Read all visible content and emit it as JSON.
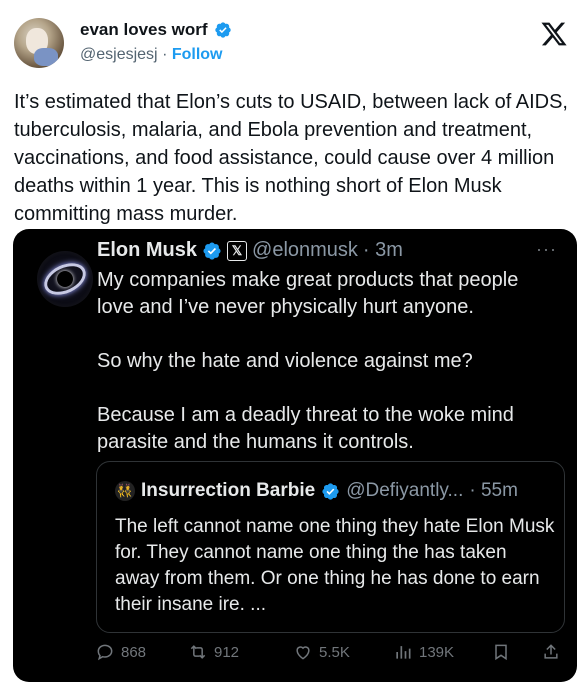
{
  "author": {
    "name": "evan loves worf",
    "handle": "@esjesjesj",
    "separator": "·",
    "follow_label": "Follow"
  },
  "tweet": {
    "text": "It’s estimated that Elon’s cuts to USAID, between lack of AIDS, tuberculosis, malaria, and Ebola prevention and treatment, vaccinations, and food assistance, could cause over 4 million deaths within 1 year. This is nothing short of Elon Musk committing mass murder."
  },
  "quoted": {
    "name": "Elon Musk",
    "x_badge": "𝕏",
    "handle": "@elonmusk",
    "time": "· 3m",
    "more": "···",
    "text": "My companies make great products that people love and I’ve never physically hurt anyone.\n\nSo why the hate and violence against me?\n\nBecause I am a deadly threat to the woke mind parasite and the humans it controls.",
    "inner": {
      "avatar_glyph": "👯",
      "name": "Insurrection Barbie",
      "handle": "@Defiyantly...",
      "time": "· 55m",
      "text": "The left cannot name one thing they hate Elon Musk for. They cannot name one thing the has taken away from them. Or one thing he has done to earn their insane ire. ..."
    },
    "actions": {
      "replies": "868",
      "reposts": "912",
      "likes": "5.5K",
      "views": "139K"
    }
  },
  "colors": {
    "verified": "#1d9bf0",
    "follow": "#1d9bf0",
    "card_bg": "#000000"
  },
  "icons": [
    "verified-icon",
    "x-logo-icon",
    "reply-icon",
    "repost-icon",
    "like-icon",
    "views-icon",
    "bookmark-icon",
    "share-icon"
  ]
}
